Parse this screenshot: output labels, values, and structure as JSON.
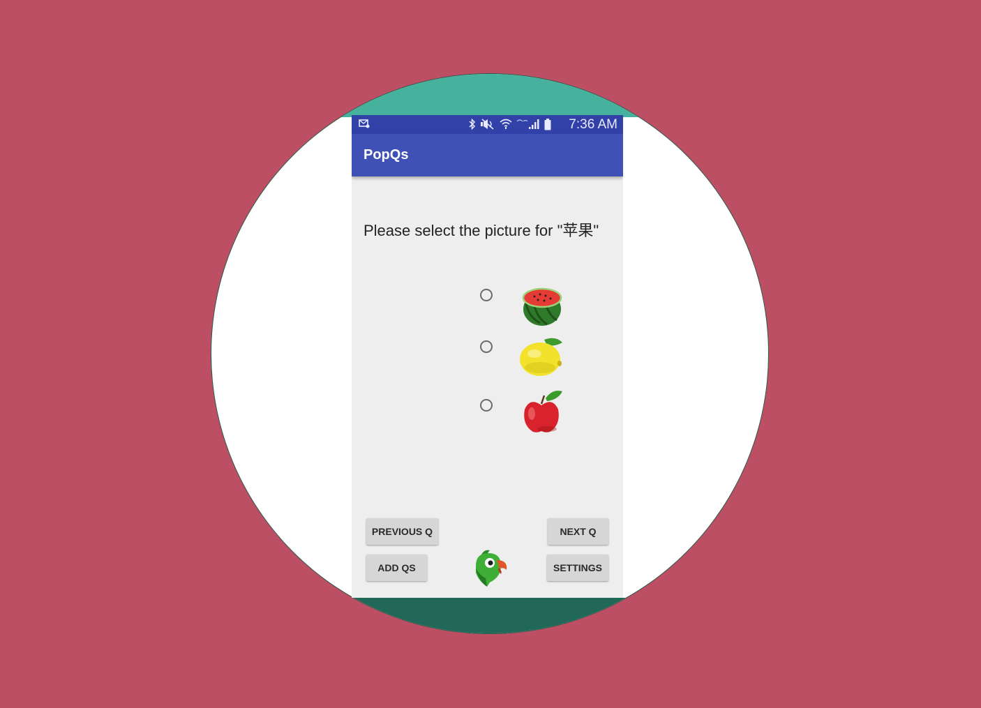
{
  "colors": {
    "background": "#bc4f63",
    "circle_fill": "#ffffff",
    "teal_top": "#46b29d",
    "teal_bottom": "#216858",
    "status_bar": "#3141a8",
    "app_bar": "#3f51b5",
    "content_bg": "#eeeeee",
    "button_bg": "#d6d6d6"
  },
  "status_bar": {
    "time": "7:36 AM",
    "icons": [
      "notification-icon",
      "bluetooth-icon",
      "mute-icon",
      "wifi-icon",
      "signal-icon",
      "battery-icon"
    ]
  },
  "app": {
    "title": "PopQs"
  },
  "question": {
    "text": "Please select the picture for \"苹果\""
  },
  "options": [
    {
      "icon": "watermelon-icon",
      "selected": false
    },
    {
      "icon": "lemon-icon",
      "selected": false
    },
    {
      "icon": "apple-icon",
      "selected": false
    }
  ],
  "buttons": {
    "previous": "PREVIOUS Q",
    "next": "NEXT Q",
    "add": "ADD QS",
    "settings": "SETTINGS"
  },
  "logo": {
    "icon": "parrot-logo-icon"
  }
}
